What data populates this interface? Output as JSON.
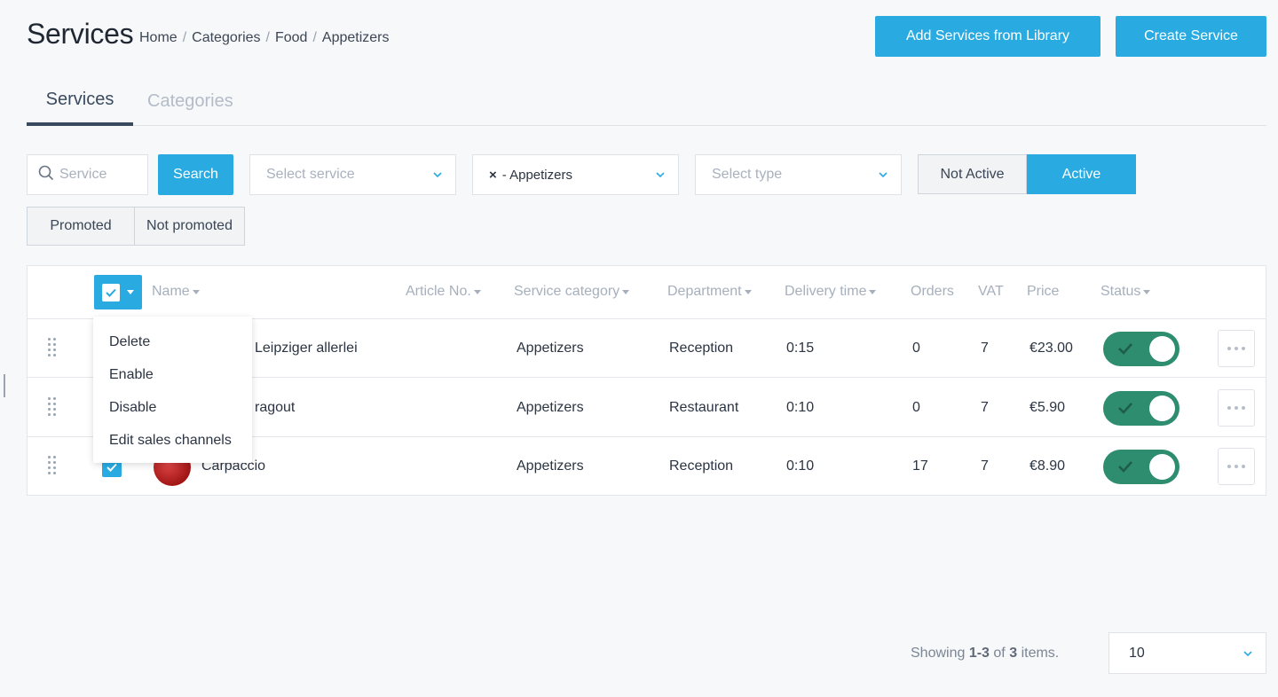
{
  "header": {
    "title": "Services",
    "breadcrumb": [
      "Home",
      "Categories",
      "Food",
      "Appetizers"
    ],
    "add_from_library_label": "Add Services from Library",
    "create_label": "Create Service"
  },
  "tabs": [
    {
      "label": "Services",
      "active": true
    },
    {
      "label": "Categories",
      "active": false
    }
  ],
  "filters": {
    "search_placeholder": "Service",
    "search_button": "Search",
    "service_select_placeholder": "Select service",
    "category_chip": "- Appetizers",
    "category_chip_remove": "×",
    "type_select_placeholder": "Select type",
    "not_active_label": "Not Active",
    "active_label": "Active",
    "promoted_label": "Promoted",
    "not_promoted_label": "Not promoted"
  },
  "table": {
    "columns": [
      "Name",
      "Article No.",
      "Service category",
      "Department",
      "Delivery time",
      "Orders",
      "VAT",
      "Price",
      "Status"
    ],
    "rows": [
      {
        "name": "Leipziger allerlei",
        "article_no": "",
        "category": "Appetizers",
        "department": "Reception",
        "delivery_time": "0:15",
        "orders": "0",
        "vat": "7",
        "price": "€23.00",
        "status_enabled": true,
        "selected": true
      },
      {
        "name": "ragout",
        "article_no": "",
        "category": "Appetizers",
        "department": "Restaurant",
        "delivery_time": "0:10",
        "orders": "0",
        "vat": "7",
        "price": "€5.90",
        "status_enabled": true,
        "selected": true
      },
      {
        "name": "Carpaccio",
        "article_no": "",
        "category": "Appetizers",
        "department": "Reception",
        "delivery_time": "0:10",
        "orders": "17",
        "vat": "7",
        "price": "€8.90",
        "status_enabled": true,
        "selected": true
      }
    ]
  },
  "bulk_menu": {
    "items": [
      "Delete",
      "Enable",
      "Disable",
      "Edit sales channels"
    ]
  },
  "footer": {
    "showing_prefix": "Showing",
    "showing_range": "1-3",
    "showing_of": "of",
    "showing_total": "3",
    "showing_suffix": "items.",
    "page_size": "10"
  },
  "colors": {
    "accent": "#29abe2",
    "toggle_on": "#2e8c6f",
    "tab_active": "#3a4a5e"
  }
}
